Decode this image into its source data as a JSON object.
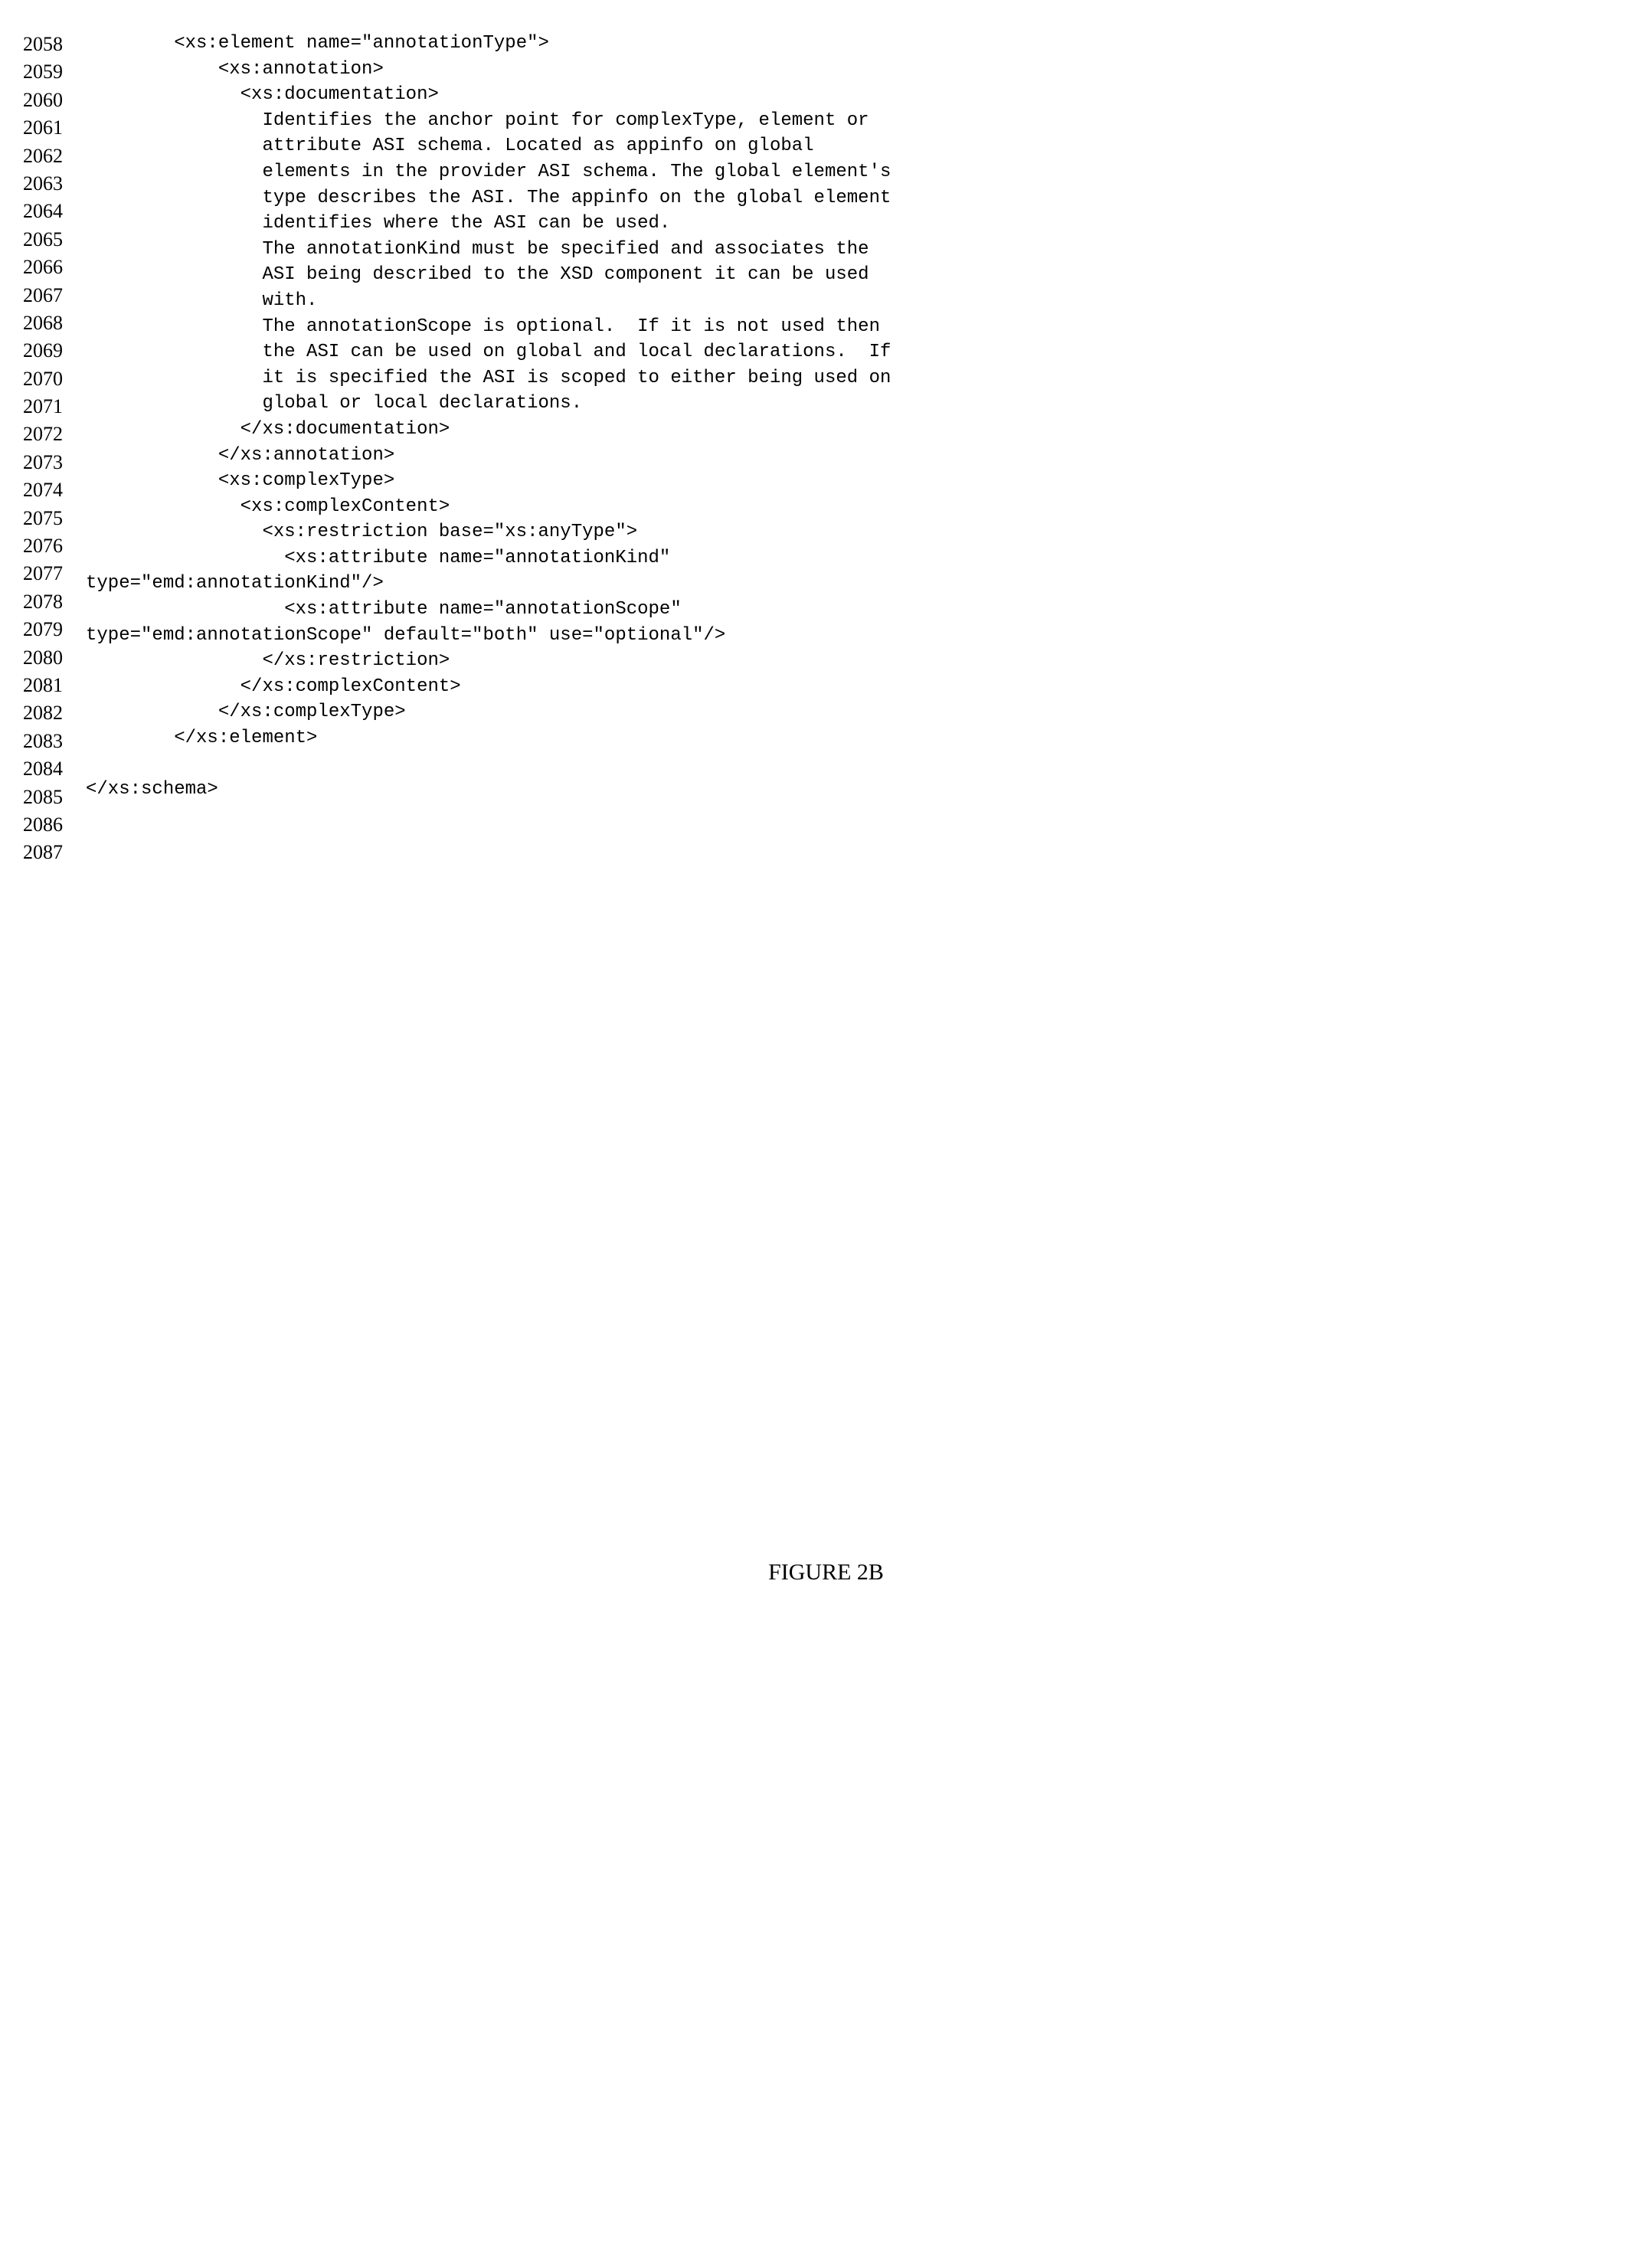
{
  "lines": [
    {
      "num": "2058",
      "code": "        <xs:element name=\"annotationType\">"
    },
    {
      "num": "2059",
      "code": "            <xs:annotation>"
    },
    {
      "num": "2060",
      "code": "              <xs:documentation>"
    },
    {
      "num": "2061",
      "code": "                Identifies the anchor point for complexType, element or"
    },
    {
      "num": "2062",
      "code": "                attribute ASI schema. Located as appinfo on global"
    },
    {
      "num": "2063",
      "code": "                elements in the provider ASI schema. The global element's"
    },
    {
      "num": "2064",
      "code": "                type describes the ASI. The appinfo on the global element"
    },
    {
      "num": "2065",
      "code": "                identifies where the ASI can be used."
    },
    {
      "num": "2066",
      "code": "                The annotationKind must be specified and associates the"
    },
    {
      "num": "2067",
      "code": "                ASI being described to the XSD component it can be used"
    },
    {
      "num": "2068",
      "code": "                with."
    },
    {
      "num": "2069",
      "code": "                The annotationScope is optional.  If it is not used then"
    },
    {
      "num": "2070",
      "code": "                the ASI can be used on global and local declarations.  If"
    },
    {
      "num": "2071",
      "code": "                it is specified the ASI is scoped to either being used on"
    },
    {
      "num": "2072",
      "code": "                global or local declarations."
    },
    {
      "num": "2073",
      "code": "              </xs:documentation>"
    },
    {
      "num": "2074",
      "code": "            </xs:annotation>"
    },
    {
      "num": "2075",
      "code": "            <xs:complexType>"
    },
    {
      "num": "2076",
      "code": "              <xs:complexContent>"
    },
    {
      "num": "2077",
      "code": "                <xs:restriction base=\"xs:anyType\">"
    },
    {
      "num": "2078",
      "code": "                  <xs:attribute name=\"annotationKind\""
    },
    {
      "num": "2079",
      "code": "type=\"emd:annotationKind\"/>"
    },
    {
      "num": "2080",
      "code": "                  <xs:attribute name=\"annotationScope\""
    },
    {
      "num": "2081",
      "code": "type=\"emd:annotationScope\" default=\"both\" use=\"optional\"/>"
    },
    {
      "num": "2082",
      "code": "                </xs:restriction>"
    },
    {
      "num": "2083",
      "code": "              </xs:complexContent>"
    },
    {
      "num": "2084",
      "code": "            </xs:complexType>"
    },
    {
      "num": "2085",
      "code": "        </xs:element>"
    },
    {
      "num": "2086",
      "code": ""
    },
    {
      "num": "2087",
      "code": "</xs:schema>"
    }
  ],
  "figure_caption": "FIGURE 2B"
}
